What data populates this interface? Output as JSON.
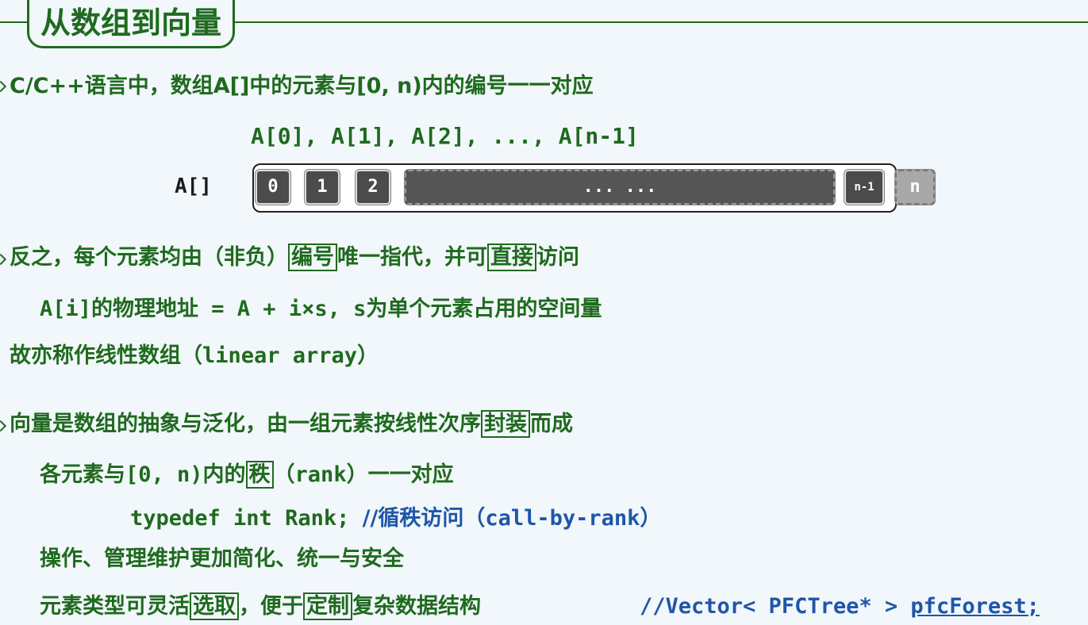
{
  "title": "从数组到向量",
  "line1": {
    "text": "C/C++语言中，数组A[]中的元素与[0, n)内的编号一一对应"
  },
  "array_seq": "A[0], A[1], A[2], ..., A[n-1]",
  "array_label": "A[]",
  "cells": [
    "0",
    "1",
    "2",
    "... ...",
    "n-1",
    "n"
  ],
  "line2": {
    "a": "反之，每个元素均由（非负）",
    "b": "编号",
    "c": "唯一指代，并可",
    "d": "直接",
    "e": "访问"
  },
  "line3": {
    "a": "A[i]",
    "b": "的物理地址",
    "c": " = A + i×s, s",
    "d": "为单个元素占用的空间量"
  },
  "line4": {
    "a": "故亦称作线性数组（",
    "b": "linear array",
    "c": "）"
  },
  "line5": {
    "a": "向量是数组的抽象与泛化，由一组元素按线性次序",
    "b": "封装",
    "c": "而成"
  },
  "line6": {
    "a": "各元素与",
    "b": "[0, n)",
    "c": "内的",
    "d": "秩",
    "e": "（",
    "f": "rank",
    "g": "）一一对应"
  },
  "line7": {
    "a": "typedef int Rank; ",
    "b": "//循秩访问（",
    "c": "call-by-rank",
    "d": "）"
  },
  "line8": {
    "text": "操作、管理维护更加简化、统一与安全"
  },
  "line9": {
    "a": "元素类型可灵活",
    "b": "选取",
    "c": "，便于",
    "d": "定制",
    "e": "复杂数据结构",
    "f": "//Vector< PFCTree* > ",
    "g": "pfcForest;"
  }
}
